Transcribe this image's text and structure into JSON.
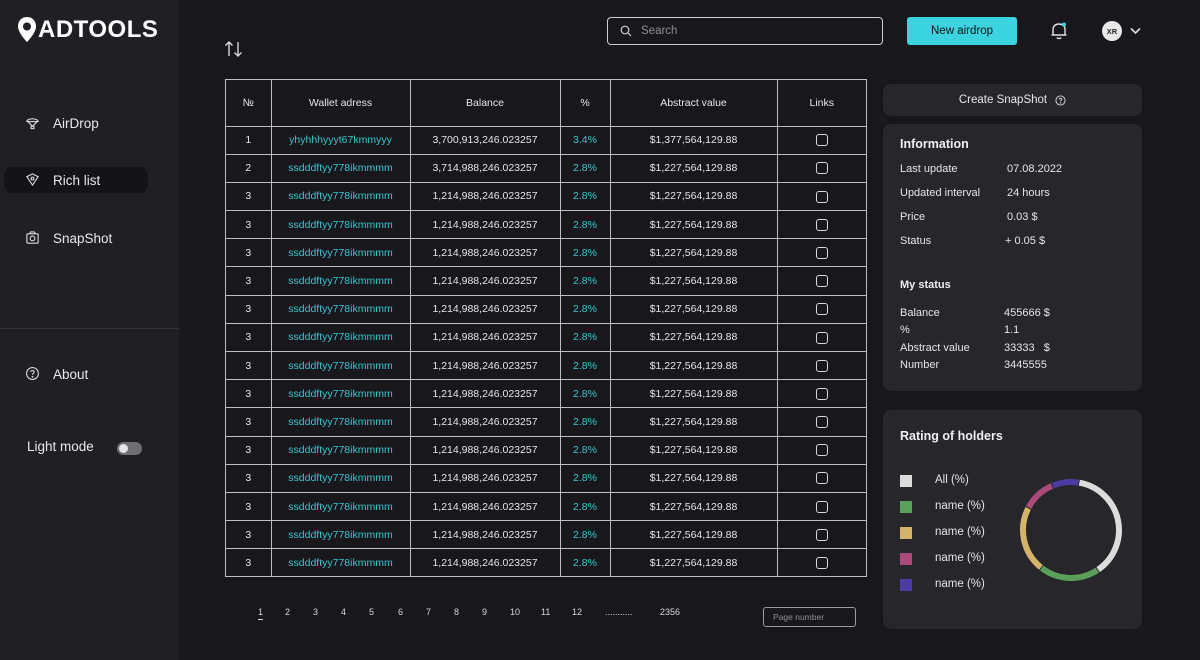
{
  "brand": {
    "name": "ADTOOLS"
  },
  "sidebar": {
    "items": [
      {
        "label": "AirDrop",
        "icon": "airdrop-icon"
      },
      {
        "label": "Rich list",
        "icon": "rich-list-icon"
      },
      {
        "label": "SnapShot",
        "icon": "snapshot-icon"
      }
    ],
    "about": {
      "label": "About",
      "icon": "help-circle-icon"
    },
    "light_mode_label": "Light mode"
  },
  "header": {
    "search_placeholder": "Search",
    "new_airdrop_label": "New airdrop",
    "avatar_initials": "XR",
    "accent": "#3bd3df"
  },
  "table": {
    "headers": [
      "№",
      "Wallet adress",
      "Balance",
      "%",
      "Abstract value",
      "Links"
    ],
    "rows": [
      {
        "n": "1",
        "addr": "yhyhhhyyyt67kmmyyy",
        "bal": "3,700,913,246.023257",
        "pct": "3.4%",
        "val": "$1,377,564,129.88"
      },
      {
        "n": "2",
        "addr": "ssdddftyy778ikmmmm",
        "bal": "3,714,988,246.023257",
        "pct": "2.8%",
        "val": "$1,227,564,129.88"
      },
      {
        "n": "3",
        "addr": "ssdddftyy778ikmmmm",
        "bal": "1,214,988,246.023257",
        "pct": "2.8%",
        "val": "$1,227,564,129.88"
      },
      {
        "n": "3",
        "addr": "ssdddftyy778ikmmmm",
        "bal": "1,214,988,246.023257",
        "pct": "2.8%",
        "val": "$1,227,564,129.88"
      },
      {
        "n": "3",
        "addr": "ssdddftyy778ikmmmm",
        "bal": "1,214,988,246.023257",
        "pct": "2.8%",
        "val": "$1,227,564,129.88"
      },
      {
        "n": "3",
        "addr": "ssdddftyy778ikmmmm",
        "bal": "1,214,988,246.023257",
        "pct": "2.8%",
        "val": "$1,227,564,129.88"
      },
      {
        "n": "3",
        "addr": "ssdddftyy778ikmmmm",
        "bal": "1,214,988,246.023257",
        "pct": "2.8%",
        "val": "$1,227,564,129.88"
      },
      {
        "n": "3",
        "addr": "ssdddftyy778ikmmmm",
        "bal": "1,214,988,246.023257",
        "pct": "2.8%",
        "val": "$1,227,564,129.88"
      },
      {
        "n": "3",
        "addr": "ssdddftyy778ikmmmm",
        "bal": "1,214,988,246.023257",
        "pct": "2.8%",
        "val": "$1,227,564,129.88"
      },
      {
        "n": "3",
        "addr": "ssdddftyy778ikmmmm",
        "bal": "1,214,988,246.023257",
        "pct": "2.8%",
        "val": "$1,227,564,129.88"
      },
      {
        "n": "3",
        "addr": "ssdddftyy778ikmmmm",
        "bal": "1,214,988,246.023257",
        "pct": "2.8%",
        "val": "$1,227,564,129.88"
      },
      {
        "n": "3",
        "addr": "ssdddftyy778ikmmmm",
        "bal": "1,214,988,246.023257",
        "pct": "2.8%",
        "val": "$1,227,564,129.88"
      },
      {
        "n": "3",
        "addr": "ssdddftyy778ikmmmm",
        "bal": "1,214,988,246.023257",
        "pct": "2.8%",
        "val": "$1,227,564,129.88"
      },
      {
        "n": "3",
        "addr": "ssdddftyy778ikmmmm",
        "bal": "1,214,988,246.023257",
        "pct": "2.8%",
        "val": "$1,227,564,129.88"
      },
      {
        "n": "3",
        "addr": "ssdddftyy778ikmmmm",
        "bal": "1,214,988,246.023257",
        "pct": "2.8%",
        "val": "$1,227,564,129.88"
      },
      {
        "n": "3",
        "addr": "ssdddftyy778ikmmmm",
        "bal": "1,214,988,246.023257",
        "pct": "2.8%",
        "val": "$1,227,564,129.88"
      }
    ]
  },
  "pagination": {
    "pages": [
      "1",
      "2",
      "3",
      "4",
      "5",
      "6",
      "7",
      "8",
      "9",
      "10",
      "11",
      "12",
      "...........",
      "2356"
    ],
    "active": "1",
    "input_placeholder": "Page number"
  },
  "snapshot_button": {
    "label": "Create SnapShot"
  },
  "information": {
    "title": "Information",
    "rows": [
      {
        "k": "Last update",
        "v": "07.08.2022"
      },
      {
        "k": "Updated interval",
        "v": "24 hours"
      },
      {
        "k": "Price",
        "v": "0.03 $"
      },
      {
        "k": "Status",
        "v": "+ 0.05 $"
      }
    ]
  },
  "my_status": {
    "title": "My status",
    "rows": [
      {
        "k": "Balance",
        "v": "455666 $"
      },
      {
        "k": "%",
        "v": "1.1"
      },
      {
        "k": "Abstract value",
        "v": "33333   $"
      },
      {
        "k": "Number",
        "v": "3445555"
      }
    ]
  },
  "rating": {
    "title": "Rating of holders",
    "legend": [
      {
        "label": "All (%)",
        "color": "#dcdcdc"
      },
      {
        "label": "name (%)",
        "color": "#5aa05a"
      },
      {
        "label": "name (%)",
        "color": "#d4b46a"
      },
      {
        "label": "name (%)",
        "color": "#a94a7a"
      },
      {
        "label": "name (%)",
        "color": "#4b3ca4"
      }
    ],
    "chart_data": {
      "type": "pie",
      "categories": [
        "All (%)",
        "name (%)",
        "name (%)",
        "name (%)",
        "name (%)"
      ],
      "values": [
        38,
        20,
        22,
        11,
        9
      ]
    }
  }
}
